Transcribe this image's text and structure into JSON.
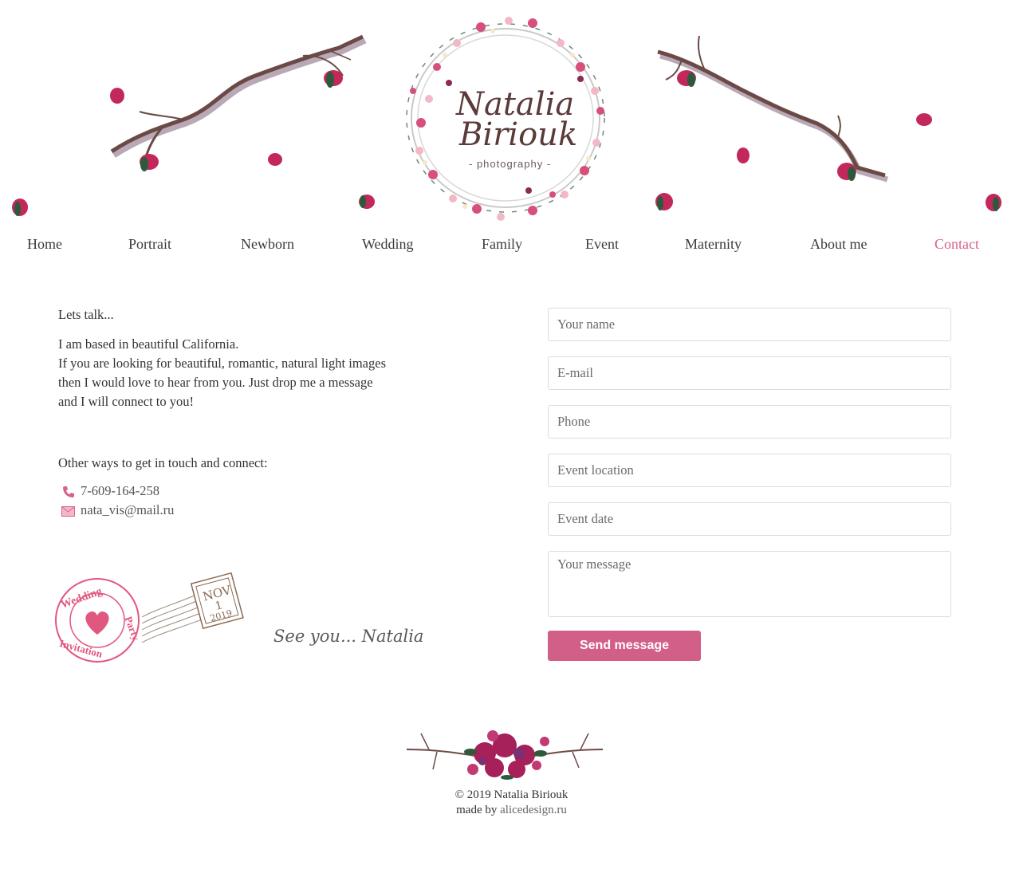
{
  "logo": {
    "line1": "Natalia",
    "line2": "Biriouk",
    "subtitle": "- photography -"
  },
  "nav": {
    "items": [
      {
        "label": "Home"
      },
      {
        "label": "Portrait"
      },
      {
        "label": "Newborn"
      },
      {
        "label": "Wedding"
      },
      {
        "label": "Family"
      },
      {
        "label": "Event"
      },
      {
        "label": "Maternity"
      },
      {
        "label": "About me"
      },
      {
        "label": "Contact",
        "active": true
      }
    ]
  },
  "intro": {
    "heading": "Lets talk...",
    "lines": [
      "I am based in beautiful California.",
      "If you are looking for beautiful, romantic, natural light images",
      "then I would love to hear from you. Just drop me a message",
      "and I will connect to you!"
    ]
  },
  "contacts": {
    "heading": "Other ways to get in touch and connect:",
    "phone": "7-609-164-258",
    "email": "nata_vis@mail.ru"
  },
  "stamp": {
    "word_top": "Wedding",
    "word_right": "Party",
    "word_bottom": "Invitation",
    "month": "NOV",
    "day": "1",
    "year": "2019"
  },
  "signature": "See you... Natalia",
  "form": {
    "name_placeholder": "Your name",
    "email_placeholder": "E-mail",
    "phone_placeholder": "Phone",
    "location_placeholder": "Event location",
    "date_placeholder": "Event date",
    "message_placeholder": "Your message",
    "submit_label": "Send message"
  },
  "footer": {
    "copyright": "© 2019 Natalia Biriouk",
    "made_by": "made by",
    "made_by_link": "alicedesign.ru"
  },
  "colors": {
    "accent": "#d9628a",
    "button": "#d15f87",
    "branch": "#6b4a46",
    "bud": "#c2285a"
  }
}
